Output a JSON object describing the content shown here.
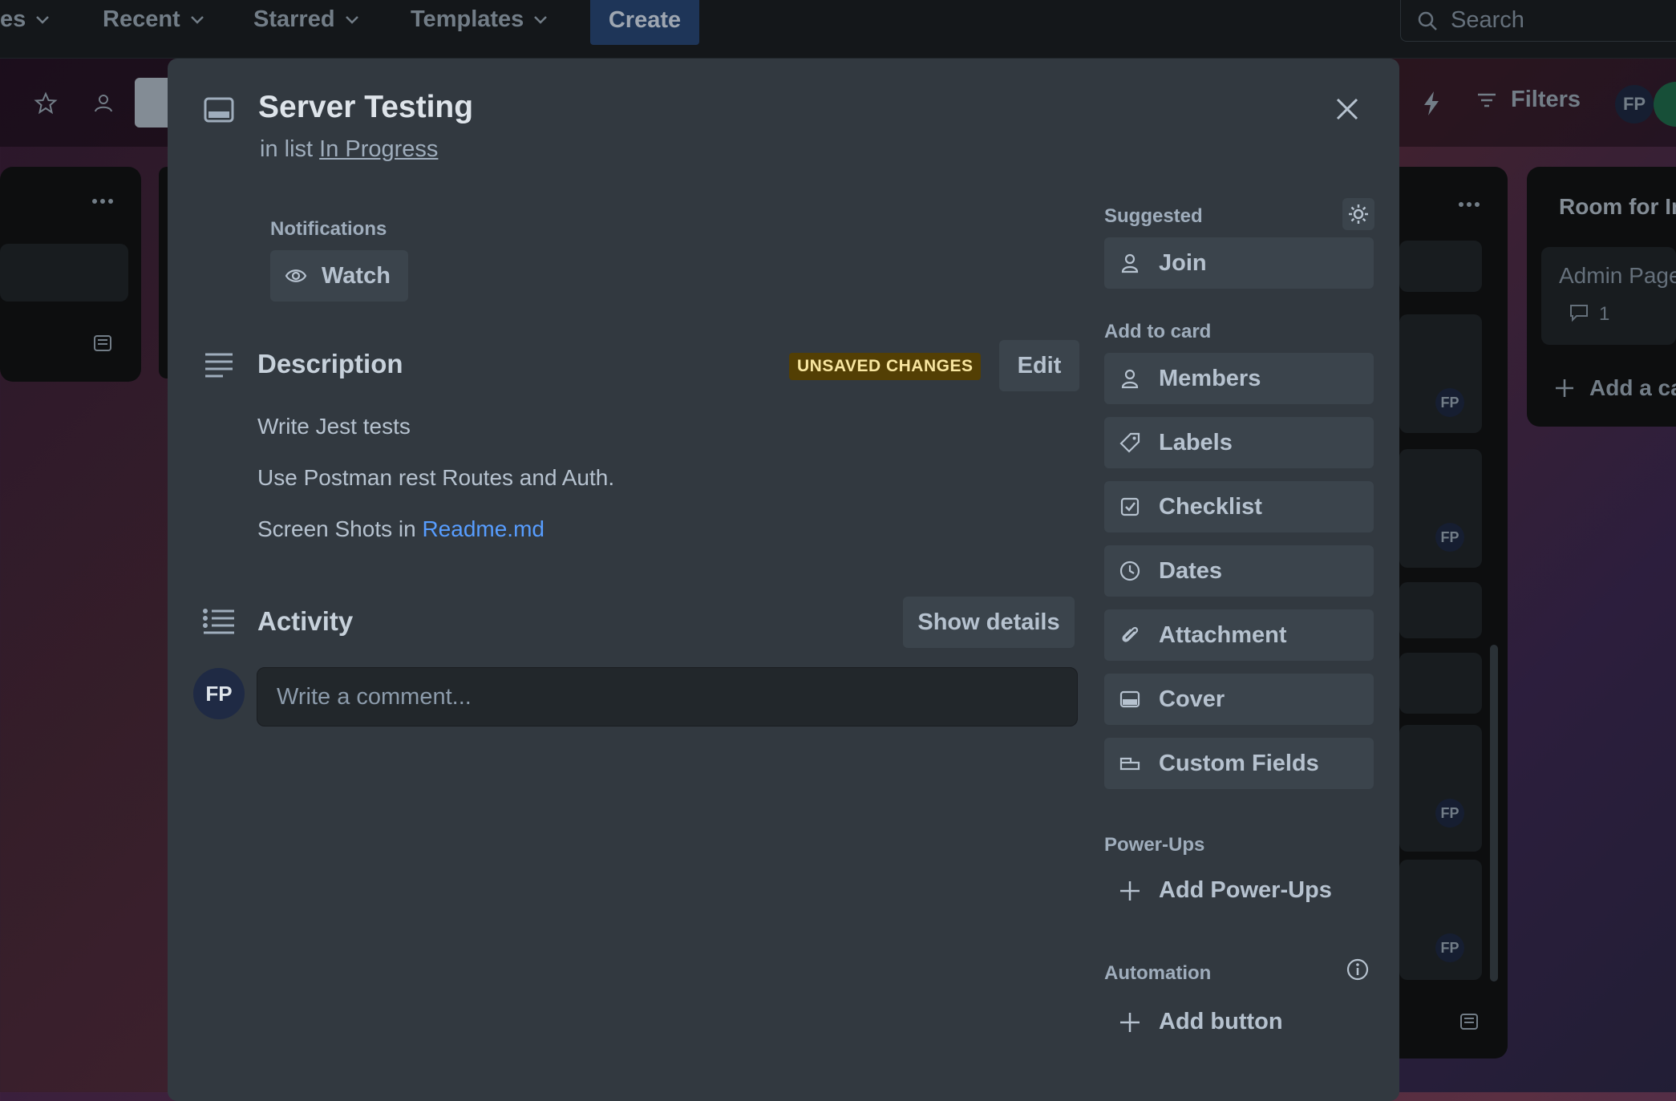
{
  "topnav": {
    "items": [
      {
        "label": "es"
      },
      {
        "label": "Recent"
      },
      {
        "label": "Starred"
      },
      {
        "label": "Templates"
      }
    ],
    "create_label": "Create",
    "search_placeholder": "Search"
  },
  "board": {
    "filters_label": "Filters",
    "member_initials": "FP",
    "right_list_title": "Room for In",
    "right_card_title": "Admin Page",
    "right_card_comments": "1",
    "add_card_label": "Add a ca",
    "card_member_initials": "FP"
  },
  "card": {
    "title": "Server Testing",
    "list_prefix": "in list",
    "list_name": "In Progress",
    "notifications_heading": "Notifications",
    "watch_label": "Watch",
    "description_heading": "Description",
    "unsaved_badge": "UNSAVED CHANGES",
    "edit_label": "Edit",
    "description_lines": [
      "Write Jest tests",
      "Use Postman rest Routes and Auth."
    ],
    "description_line3_prefix": "Screen Shots in ",
    "description_line3_link": "Readme.md",
    "activity_heading": "Activity",
    "show_details_label": "Show details",
    "commenter_initials": "FP",
    "comment_placeholder": "Write a comment..."
  },
  "sidebar": {
    "suggested_heading": "Suggested",
    "join_label": "Join",
    "add_to_card_heading": "Add to card",
    "actions": [
      {
        "label": "Members",
        "icon": "person-icon"
      },
      {
        "label": "Labels",
        "icon": "tag-icon"
      },
      {
        "label": "Checklist",
        "icon": "checkbox-icon"
      },
      {
        "label": "Dates",
        "icon": "clock-icon"
      },
      {
        "label": "Attachment",
        "icon": "paperclip-icon"
      },
      {
        "label": "Cover",
        "icon": "card-cover-icon"
      },
      {
        "label": "Custom Fields",
        "icon": "custom-fields-icon"
      }
    ],
    "powerups_heading": "Power-Ups",
    "add_powerups_label": "Add Power-Ups",
    "automation_heading": "Automation",
    "add_button_label": "Add button"
  },
  "colors": {
    "modal_bg": "#323940",
    "button_bg": "#3b444c",
    "link": "#579dff",
    "unsaved_bg": "#533f04",
    "unsaved_text": "#f8e6a0"
  }
}
